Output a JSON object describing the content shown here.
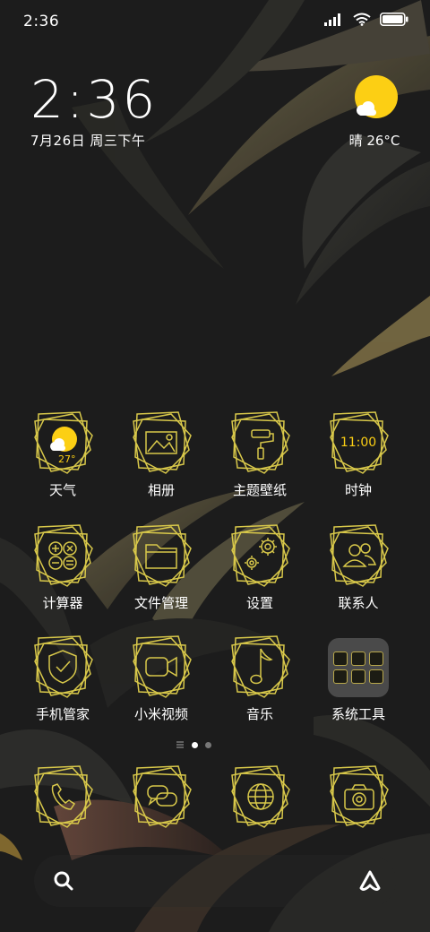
{
  "status_bar": {
    "time": "2:36"
  },
  "clock_widget": {
    "time": "2:36",
    "date": "7月26日 周三下午"
  },
  "weather_widget": {
    "text": "晴 26°C"
  },
  "apps": {
    "weather": {
      "label": "天气",
      "temp": "27°"
    },
    "gallery": {
      "label": "相册"
    },
    "themes": {
      "label": "主题壁纸"
    },
    "clock": {
      "label": "时钟",
      "icon_text": "11:00"
    },
    "calculator": {
      "label": "计算器"
    },
    "files": {
      "label": "文件管理"
    },
    "settings": {
      "label": "设置"
    },
    "contacts": {
      "label": "联系人"
    },
    "security": {
      "label": "手机管家"
    },
    "video": {
      "label": "小米视频"
    },
    "music": {
      "label": "音乐"
    },
    "system_tools": {
      "label": "系统工具"
    }
  },
  "dock": [
    "phone-icon",
    "messages-icon",
    "browser-icon",
    "camera-icon"
  ],
  "colors": {
    "accent": "#d8c84a",
    "sun": "#fccf14",
    "background": "#1b1b1b"
  }
}
